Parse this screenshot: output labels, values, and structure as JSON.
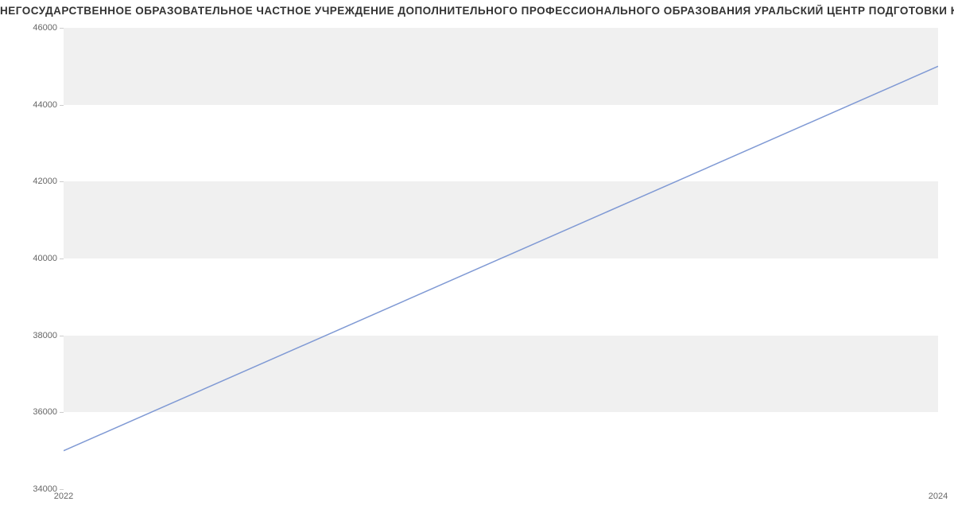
{
  "chart_data": {
    "type": "line",
    "title": "НЕГОСУДАРСТВЕННОЕ ОБРАЗОВАТЕЛЬНОЕ ЧАСТНОЕ УЧРЕЖДЕНИЕ ДОПОЛНИТЕЛЬНОГО ПРОФЕССИОНАЛЬНОГО ОБРАЗОВАНИЯ УРАЛЬСКИЙ ЦЕНТР ПОДГОТОВКИ КАДРОВ | Данные",
    "x": [
      2022,
      2024
    ],
    "values": [
      35000,
      45000
    ],
    "xlim": [
      2022,
      2024
    ],
    "ylim": [
      34000,
      46000
    ],
    "xticks": [
      2022,
      2024
    ],
    "yticks": [
      34000,
      36000,
      38000,
      40000,
      42000,
      44000,
      46000
    ],
    "line_color": "#7f99d4",
    "band_color": "#f0f0f0"
  }
}
